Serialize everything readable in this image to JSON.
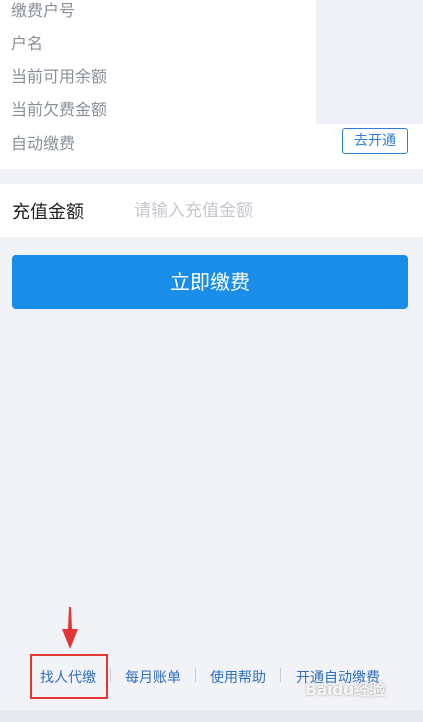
{
  "account_info": {
    "rows": [
      {
        "label": "缴费户号"
      },
      {
        "label": "户名"
      },
      {
        "label": "当前可用余额"
      },
      {
        "label": "当前欠费金额"
      },
      {
        "label": "自动缴费"
      }
    ],
    "auto_pay_button": "去开通"
  },
  "recharge": {
    "label": "充值金额",
    "placeholder": "请输入充值金额",
    "value": ""
  },
  "pay_button": "立即缴费",
  "footer": {
    "links": [
      "找人代缴",
      "每月账单",
      "使用帮助",
      "开通自动缴费"
    ]
  },
  "watermark": "Baidu经验",
  "colors": {
    "primary_button": "#1a8de8",
    "link": "#2f6fbf",
    "annotation": "#e53535"
  },
  "icons": [
    "red-arrow-annotation-icon"
  ]
}
